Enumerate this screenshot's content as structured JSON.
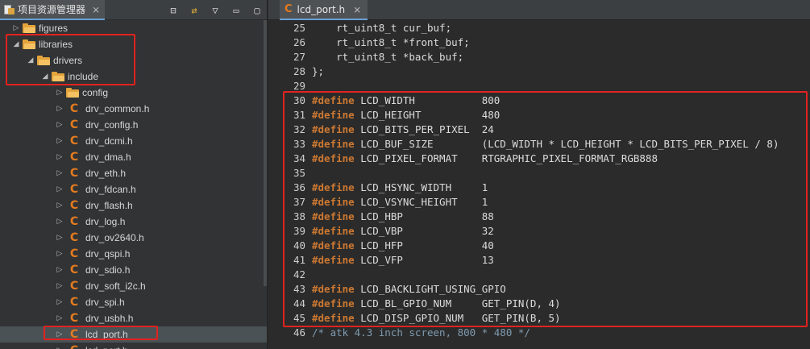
{
  "explorer": {
    "title": "项目资源管理器",
    "close_glyph": "⨯",
    "tools": [
      "⊟",
      "⇄",
      "▽",
      "▭",
      "▢"
    ],
    "items": [
      {
        "label": "figures",
        "kind": "folder",
        "arrow": "▷",
        "depth": 0
      },
      {
        "label": "libraries",
        "kind": "folder",
        "arrow": "◢",
        "depth": 0
      },
      {
        "label": "drivers",
        "kind": "folder",
        "arrow": "◢",
        "depth": 1
      },
      {
        "label": "include",
        "kind": "folder",
        "arrow": "◢",
        "depth": 2
      },
      {
        "label": "config",
        "kind": "folder",
        "arrow": "▷",
        "depth": 3
      },
      {
        "label": "drv_common.h",
        "kind": "file",
        "arrow": "▷",
        "depth": 3
      },
      {
        "label": "drv_config.h",
        "kind": "file",
        "arrow": "▷",
        "depth": 3
      },
      {
        "label": "drv_dcmi.h",
        "kind": "file",
        "arrow": "▷",
        "depth": 3
      },
      {
        "label": "drv_dma.h",
        "kind": "file",
        "arrow": "▷",
        "depth": 3
      },
      {
        "label": "drv_eth.h",
        "kind": "file",
        "arrow": "▷",
        "depth": 3
      },
      {
        "label": "drv_fdcan.h",
        "kind": "file",
        "arrow": "▷",
        "depth": 3
      },
      {
        "label": "drv_flash.h",
        "kind": "file",
        "arrow": "▷",
        "depth": 3
      },
      {
        "label": "drv_log.h",
        "kind": "file",
        "arrow": "▷",
        "depth": 3
      },
      {
        "label": "drv_ov2640.h",
        "kind": "file",
        "arrow": "▷",
        "depth": 3
      },
      {
        "label": "drv_qspi.h",
        "kind": "file",
        "arrow": "▷",
        "depth": 3
      },
      {
        "label": "drv_sdio.h",
        "kind": "file",
        "arrow": "▷",
        "depth": 3
      },
      {
        "label": "drv_soft_i2c.h",
        "kind": "file",
        "arrow": "▷",
        "depth": 3
      },
      {
        "label": "drv_spi.h",
        "kind": "file",
        "arrow": "▷",
        "depth": 3
      },
      {
        "label": "drv_usbh.h",
        "kind": "file",
        "arrow": "▷",
        "depth": 3
      },
      {
        "label": "lcd_port.h",
        "kind": "file",
        "arrow": "▷",
        "depth": 3,
        "selected": true
      },
      {
        "label": "lcd_port.h",
        "kind": "file",
        "arrow": "▷",
        "depth": 3
      }
    ]
  },
  "editor": {
    "tab_icon": "C",
    "tab_title": "lcd_port.h",
    "close_glyph": "⨯",
    "lines": [
      {
        "n": "25",
        "kw": "",
        "text": "    rt_uint8_t cur_buf;"
      },
      {
        "n": "26",
        "kw": "",
        "text": "    rt_uint8_t *front_buf;"
      },
      {
        "n": "27",
        "kw": "",
        "text": "    rt_uint8_t *back_buf;"
      },
      {
        "n": "28",
        "kw": "",
        "text": "};"
      },
      {
        "n": "29",
        "kw": "",
        "text": ""
      },
      {
        "n": "30",
        "kw": "#define",
        "text": " LCD_WIDTH           800"
      },
      {
        "n": "31",
        "kw": "#define",
        "text": " LCD_HEIGHT          480"
      },
      {
        "n": "32",
        "kw": "#define",
        "text": " LCD_BITS_PER_PIXEL  24"
      },
      {
        "n": "33",
        "kw": "#define",
        "text": " LCD_BUF_SIZE        (LCD_WIDTH * LCD_HEIGHT * LCD_BITS_PER_PIXEL / 8)"
      },
      {
        "n": "34",
        "kw": "#define",
        "text": " LCD_PIXEL_FORMAT    RTGRAPHIC_PIXEL_FORMAT_RGB888"
      },
      {
        "n": "35",
        "kw": "",
        "text": ""
      },
      {
        "n": "36",
        "kw": "#define",
        "text": " LCD_HSYNC_WIDTH     1"
      },
      {
        "n": "37",
        "kw": "#define",
        "text": " LCD_VSYNC_HEIGHT    1"
      },
      {
        "n": "38",
        "kw": "#define",
        "text": " LCD_HBP             88"
      },
      {
        "n": "39",
        "kw": "#define",
        "text": " LCD_VBP             32"
      },
      {
        "n": "40",
        "kw": "#define",
        "text": " LCD_HFP             40"
      },
      {
        "n": "41",
        "kw": "#define",
        "text": " LCD_VFP             13"
      },
      {
        "n": "42",
        "kw": "",
        "text": ""
      },
      {
        "n": "43",
        "kw": "#define",
        "text": " LCD_BACKLIGHT_USING_GPIO"
      },
      {
        "n": "44",
        "kw": "#define",
        "text": " LCD_BL_GPIO_NUM     GET_PIN(D, 4)"
      },
      {
        "n": "45",
        "kw": "#define",
        "text": " LCD_DISP_GPIO_NUM   GET_PIN(B, 5)"
      },
      {
        "n": "46",
        "kw": "",
        "text": "/* atk 4.3 inch screen, 800 * 480 */",
        "comment": true
      }
    ]
  },
  "colors": {
    "highlight": "#e0231f",
    "keyword": "#cc7832",
    "file_icon": "#e37b1f",
    "folder": "#e3a33b"
  }
}
